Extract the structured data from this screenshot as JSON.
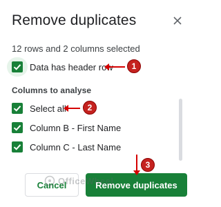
{
  "dialog": {
    "title": "Remove duplicates",
    "close_icon": "close-icon",
    "subtitle": "12 rows and 2 columns selected"
  },
  "header_option": {
    "label": "Data has header row",
    "checked": true
  },
  "columns": {
    "section_title": "Columns to analyse",
    "items": [
      {
        "label": "Select all",
        "checked": true
      },
      {
        "label": "Column B - First Name",
        "checked": true
      },
      {
        "label": "Column C - Last Name",
        "checked": true
      }
    ]
  },
  "buttons": {
    "cancel": "Cancel",
    "remove": "Remove duplicates"
  },
  "annotations": {
    "badges": [
      "1",
      "2",
      "3"
    ],
    "color": "#d50000"
  },
  "watermark": {
    "text": "OfficeWheel"
  },
  "colors": {
    "accent": "#188038",
    "highlight": "#e6f4ea"
  }
}
